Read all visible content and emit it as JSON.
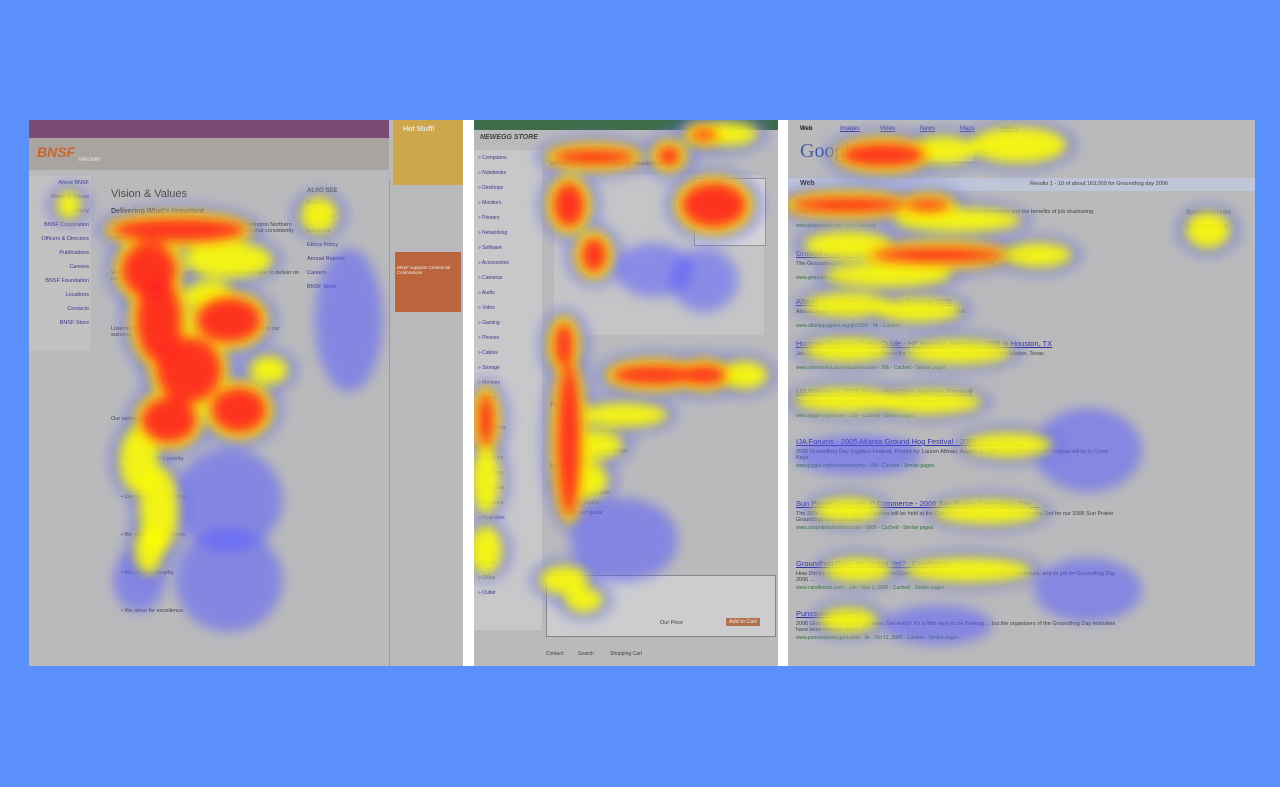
{
  "colors": {
    "background": "#5b8ff9",
    "panel_gray": "#c7c7c7",
    "separator": "#ffffff",
    "heat_low": "#5a5cff",
    "heat_mid": "#ffff00",
    "heat_high": "#ff2020",
    "link_blue": "#2222aa",
    "bnsf_orange": "#e06010"
  },
  "panel_bnsf": {
    "logo": "BNSF",
    "logo_sub": "RAILWAY",
    "nav_items": [
      "About BNSF",
      "Vision & Values",
      "History",
      "BNSF Corporation",
      "Officers & Directors",
      "Publications",
      "Careers",
      "BNSF Foundation",
      "Locations",
      "Contacts",
      "BNSF Store"
    ],
    "heading": "Vision & Values",
    "subheading": "Delivering What's Important",
    "para1": "Our vision is to realize the tremendous potential of the Burlington Northern and Santa Fe Railway by providing transportation services that consistently meet our customers' expectations.",
    "para2": "We will accomplish our vision when we are a railroad that is able to deliver on our promises to customers.",
    "para3": "Listening to customers and meeting their needs is fundamental to our success.",
    "para4": "Our values guide our decisions and actions each day.",
    "side_heading": "ALSO SEE",
    "side_links": [
      "Railway",
      "Corporation",
      "Locations",
      "Ethics Policy",
      "Annual Reports",
      "Careers",
      "BNSF Store"
    ],
    "promo_title": "Hot Stuff!",
    "promo_box": "BNSF supports Centennial Celebrations",
    "bullets": [
      "Safety is our first priority.",
      "Our customers come first.",
      "We value our employees.",
      "We act with integrity.",
      "We strive for excellence."
    ]
  },
  "panel_store": {
    "logo": "NEWEGG STORE",
    "categories": [
      "Computers",
      "Notebooks",
      "Desktops",
      "Monitors",
      "Printers",
      "Networking",
      "Software",
      "Accessories",
      "Cameras",
      "Audio",
      "Video",
      "Gaming",
      "Phones",
      "Cables",
      "Storage",
      "Memory",
      "Cases",
      "Power",
      "Keyboards",
      "Mice",
      "Speakers",
      "Headsets",
      "Webcams",
      "Scanners",
      "Projectors",
      "TV",
      "GPS",
      "Home",
      "Office",
      "Outlet"
    ],
    "product_title": "Wireless Stereo Bluetooth Headphones",
    "features_heading": "Features",
    "features": [
      "Wireless freedom up to 33 feet",
      "Integrated microphone",
      "Rechargeable battery",
      "Lightweight foldable design"
    ],
    "inside_heading": "Inside the box",
    "inside_items": [
      "Headset",
      "USB charging cable",
      "Carrying pouch",
      "Quick start guide"
    ],
    "cart_label": "Add to Cart",
    "price_label": "Our Price",
    "footer_links": [
      "Contact",
      "Search",
      "Shopping Cart"
    ]
  },
  "panel_search": {
    "tabs": [
      "Web",
      "Images",
      "Video",
      "News",
      "Maps",
      "more »"
    ],
    "logo": "Google",
    "search_button": "Search",
    "web_label": "Web",
    "results_summary": "Results 1 - 10 of about 163,000 for Groundhog day 2006",
    "sponsored": [
      "Sponsored Links",
      "Groundhog Day"
    ],
    "results": [
      {
        "title": "Groundhog Job Shadow Day",
        "snippet": "Describes a project that begins on Groundhog Day, coupled with the wisdom of mentors and the benefits of job shadowing.",
        "url": "www.jobshadow.org/ - 11k - Cached"
      },
      {
        "title": "Groundhog.org - the Official Site of the Punxsutawney Groundhog Club",
        "snippet": "The Groundhog Day 2006 celebration is history! Visit our site for the latest on Phil.",
        "url": "www.groundhog.org/ - 15k - Cached - Similar pages"
      },
      {
        "title": "Atlanta Groundhog Day Jugglers Festival 2006",
        "snippet": "Atlanta Jugglers Association - Groundhog Day Jugglers Festival 2006.",
        "url": "www.atlantajugglers.org/gh2006/ - 8k - Cached"
      },
      {
        "title": "Houston Marathon Event Guide - HP Houston Marathon 2006 in Houston, TX",
        "snippet": "Jan 15, 2006 ... The Houston Marathon is the largest single day sporting event held in Houston, Texas.",
        "url": "www.chevronhoustonmarathon.com/ - 26k - Cached - Similar pages"
      },
      {
        "title": "IJA Forums > 2006 Groundhog Day Jugglers Festival",
        "snippet": "Groundhog Day Jugglers Festival Atlanta, Georgia February 3, 4, 5, 2006.",
        "url": "www.juggle.org/forum/ - 20k - Cached - Similar pages"
      },
      {
        "title": "IJA Forums - 2005 Atlanta Ground Hog Festival - 2006 Groundhog ...",
        "snippet": "2005 Groundhog Day Jugglers Festival. Posted by: Lauren Allman, August 11, 2005 02:27PM. The 2006 Festival will be in Cross Keys.",
        "url": "www.juggle.org/forum/read.php - 19k - Cached - Similar pages"
      },
      {
        "title": "Sun Prairie Chamber of Commerce - 2006 Sun Prairie Groundhog Day ...",
        "snippet": "The 2006 Groundhog Day Celebration will be held at the Colonial Club on ... to host year on February 2nd for our 2006 Sun Prairie Groundhog Day celebration.",
        "url": "www.sunprairiechamber.com/ - 2005 - Cached - Similar pages"
      },
      {
        "title": "Groundhog Day - It's Spring Yet? - Candlemas",
        "snippet": "How Did the Groundhog Get a Day of His Own? The early groundhog was once called a woodchuck, and its job on Groundhog Day 2006 ...",
        "url": "www.candlemas.com/ - 14k - Nov 1, 2006 - Cached - Similar pages"
      },
      {
        "title": "Punxsutawney Phil",
        "snippet": "2006 Groundhog Day is nearly here. Get ready! It's a little early to be thinking ... but the organizers of the Groundhog Day festivities have been thinking about ...",
        "url": "www.punxsutawneyphil.com/ - 9k - Oct 11, 2006 - Cached - Similar pages"
      }
    ]
  }
}
